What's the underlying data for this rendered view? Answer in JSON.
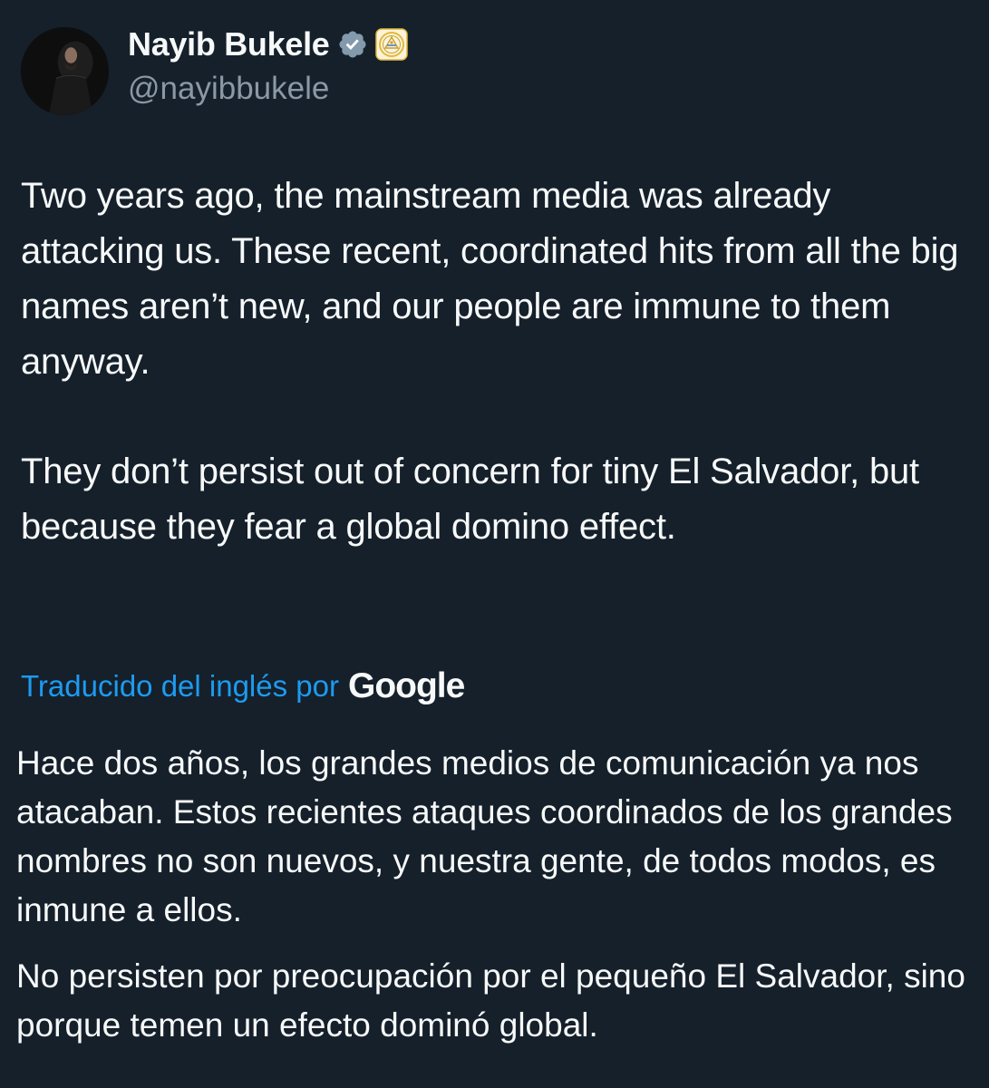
{
  "tweet": {
    "author": {
      "display_name": "Nayib Bukele",
      "handle": "@nayibbukele",
      "avatar": "avatar",
      "verified_icon": "verified-badge-icon",
      "affiliation_icon": "government-seal-icon"
    },
    "paragraphs": [
      "Two years ago, the mainstream media was already attacking us. These recent, coordinated hits from all the big names aren’t new, and our people are immune to them anyway.",
      "They don’t persist out of concern for tiny El Salvador, but because they fear a global domino effect."
    ],
    "translation": {
      "label": "Traducido del inglés por",
      "provider": "Google",
      "paragraphs": [
        "Hace dos años, los grandes medios de comunicación ya nos atacaban. Estos recientes ataques coordinados de los grandes nombres no son nuevos, y nuestra gente, de todos modos, es inmune a ellos.",
        "No persisten por preocupación por el pequeño El Salvador, sino porque temen un efecto dominó global."
      ]
    }
  },
  "colors": {
    "background": "#15202b",
    "text": "#f7f9f9",
    "secondary_text": "#8b98a5",
    "link": "#1d9bf0",
    "verified_badge": "#829aab",
    "seal": "#e2b93b"
  }
}
